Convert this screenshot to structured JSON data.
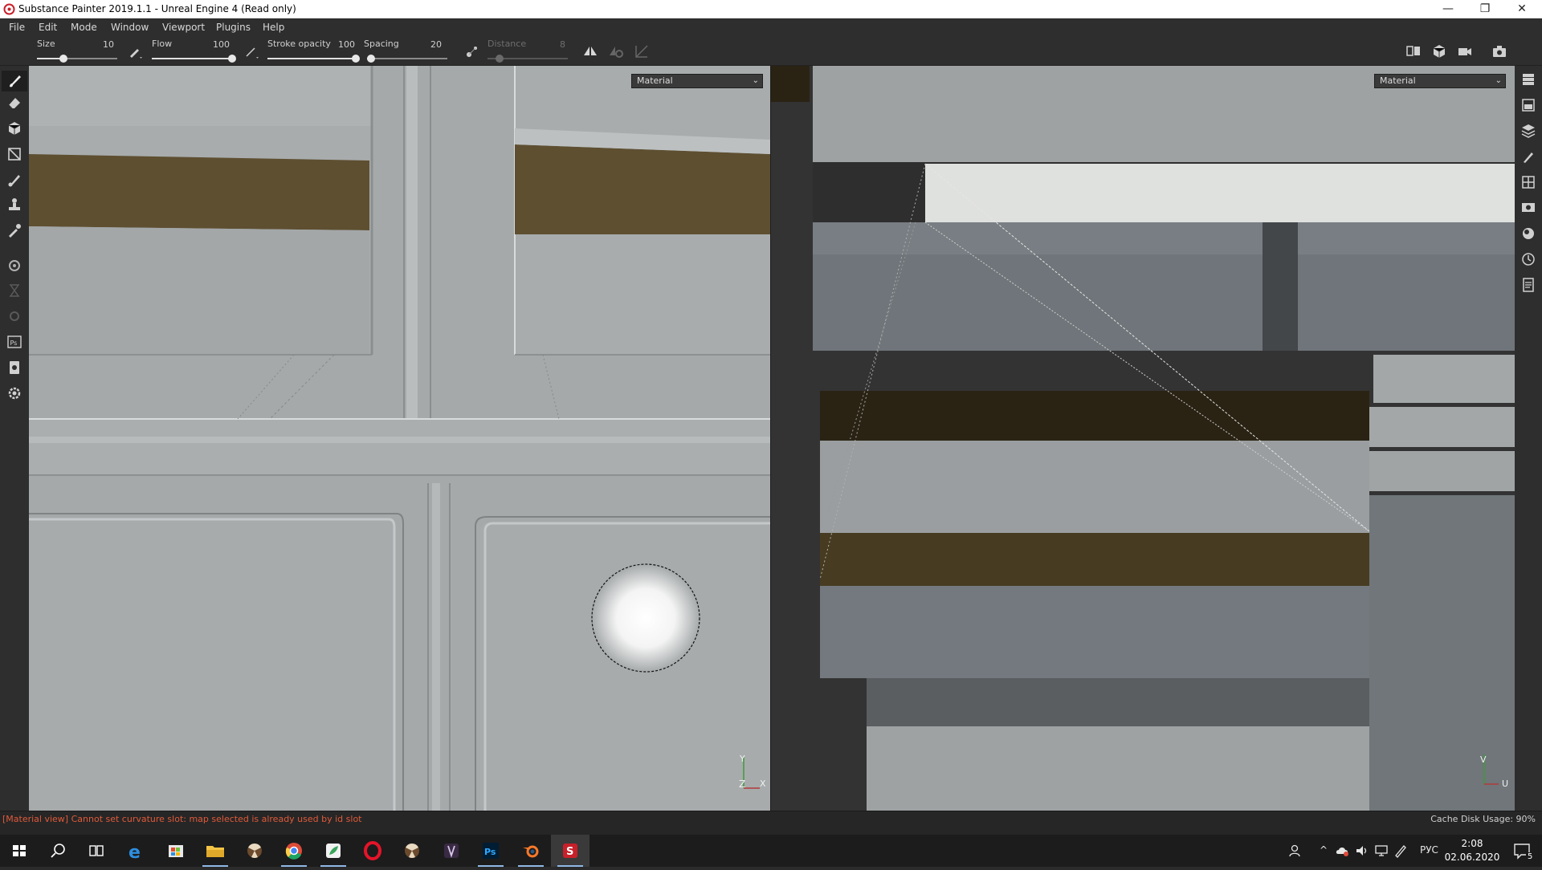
{
  "window": {
    "title": "Substance Painter 2019.1.1 - Unreal Engine 4 (Read only)"
  },
  "menu": [
    "File",
    "Edit",
    "Mode",
    "Window",
    "Viewport",
    "Plugins",
    "Help"
  ],
  "toolbar": {
    "size_label": "Size",
    "size_value": "10",
    "size_level": 0.33,
    "flow_label": "Flow",
    "flow_value": "100",
    "flow_level": 1.0,
    "opacity_label": "Stroke opacity",
    "opacity_value": "100",
    "opacity_level": 1.0,
    "spacing_label": "Spacing",
    "spacing_value": "20",
    "spacing_level": 0.05,
    "distance_label": "Distance",
    "distance_value": "8",
    "distance_level": 0.15
  },
  "viewport3d": {
    "mode_select": "Material",
    "axis_y": "Y",
    "axis_z": "Z",
    "axis_x": "X"
  },
  "viewport2d": {
    "mode_select": "Material",
    "axis_v": "V",
    "axis_u": "U"
  },
  "status": {
    "message": "[Material view] Cannot set curvature slot: map selected is already used by id slot",
    "cache": "Cache Disk Usage:   90%"
  },
  "taskbar": {
    "language": "РУС",
    "time": "2:08",
    "date": "02.06.2020",
    "notifications": "5"
  },
  "colors": {
    "accent_brown": "#5e4f31",
    "dark_brown": "#2a2314",
    "error": "#e05a3a"
  }
}
